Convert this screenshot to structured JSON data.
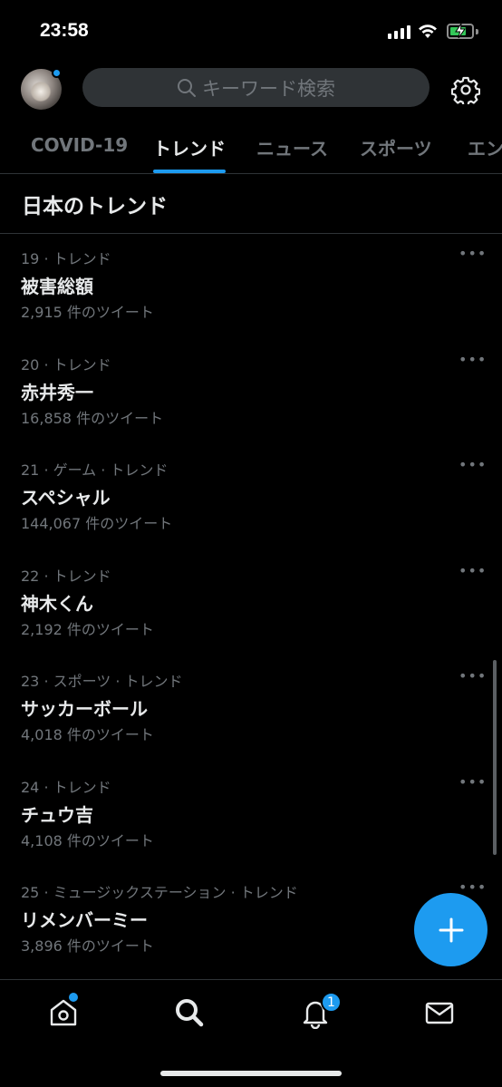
{
  "status_bar": {
    "time": "23:58"
  },
  "search": {
    "placeholder": "キーワード検索"
  },
  "tabs": [
    {
      "label": "COVID-19",
      "active": false
    },
    {
      "label": "トレンド",
      "active": true
    },
    {
      "label": "ニュース",
      "active": false
    },
    {
      "label": "スポーツ",
      "active": false
    },
    {
      "label": "エン",
      "active": false
    }
  ],
  "section": {
    "title": "日本のトレンド"
  },
  "trends": [
    {
      "meta": "19 · トレンド",
      "name": "被害総額",
      "count": "2,915 件のツイート"
    },
    {
      "meta": "20 · トレンド",
      "name": "赤井秀一",
      "count": "16,858 件のツイート"
    },
    {
      "meta": "21 · ゲーム · トレンド",
      "name": "スペシャル",
      "count": "144,067 件のツイート"
    },
    {
      "meta": "22 · トレンド",
      "name": "神木くん",
      "count": "2,192 件のツイート"
    },
    {
      "meta": "23 · スポーツ · トレンド",
      "name": "サッカーボール",
      "count": "4,018 件のツイート"
    },
    {
      "meta": "24 · トレンド",
      "name": "チュウ吉",
      "count": "4,108 件のツイート"
    },
    {
      "meta": "25 · ミュージックステーション · トレンド",
      "name": "リメンバーミー",
      "count": "3,896 件のツイート"
    }
  ],
  "more_label": "•••",
  "bottom_nav": {
    "notification_badge": "1"
  },
  "colors": {
    "accent": "#1d9bf0",
    "background": "#000000",
    "muted_text": "#71767b",
    "primary_text": "#e7e9ea"
  }
}
